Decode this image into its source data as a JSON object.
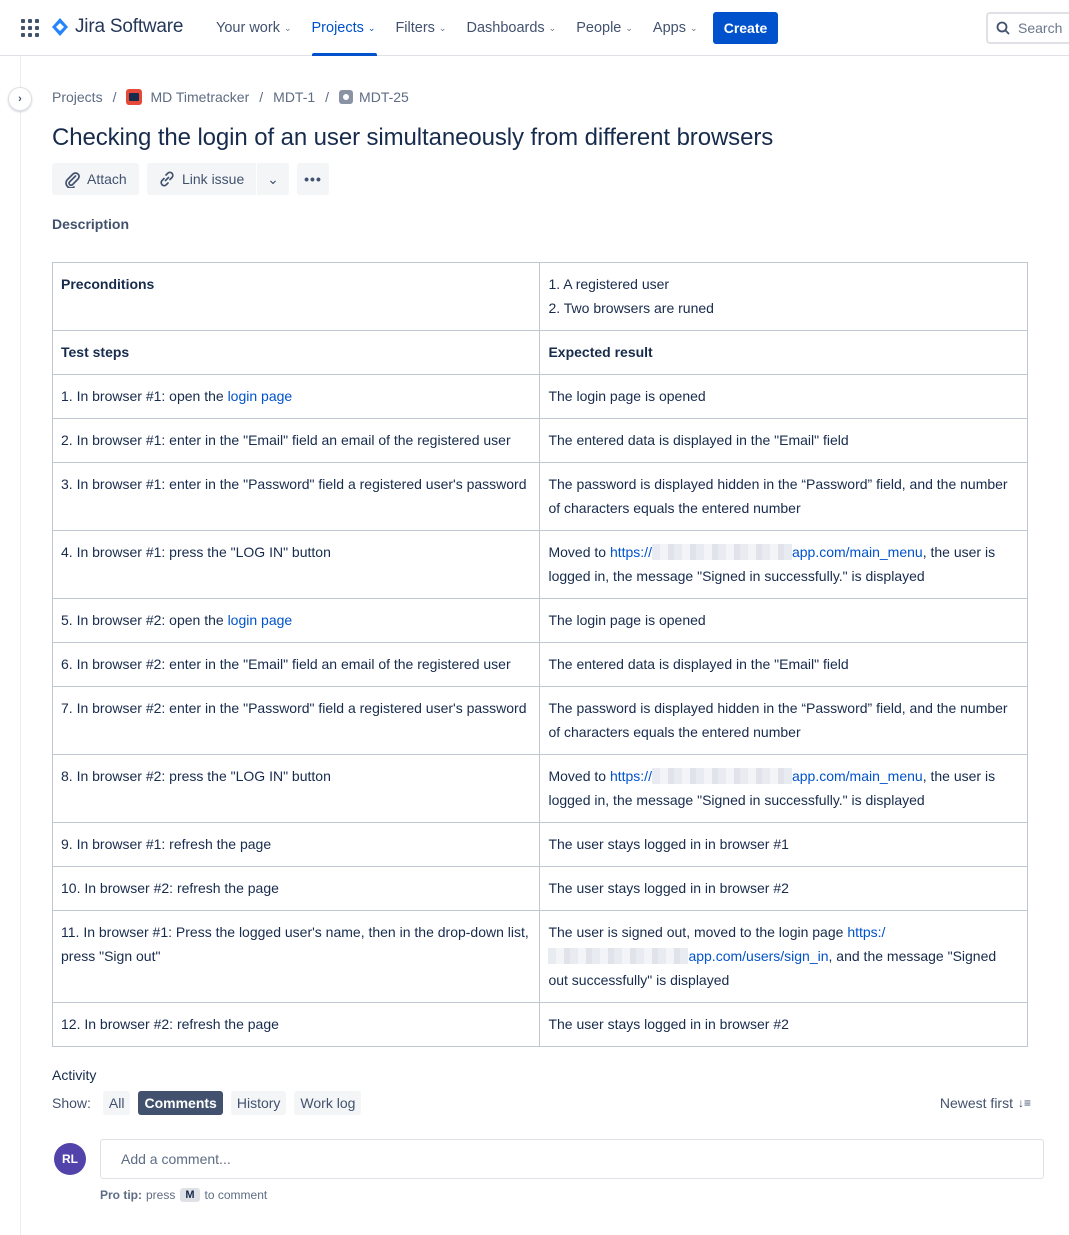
{
  "nav": {
    "product_name": "Jira Software",
    "items": [
      {
        "label": "Your work"
      },
      {
        "label": "Projects"
      },
      {
        "label": "Filters"
      },
      {
        "label": "Dashboards"
      },
      {
        "label": "People"
      },
      {
        "label": "Apps"
      }
    ],
    "active_item": "Projects",
    "create_label": "Create",
    "search_placeholder": "Search"
  },
  "breadcrumb": {
    "items": [
      "Projects",
      "MD Timetracker",
      "MDT-1",
      "MDT-25"
    ],
    "separator": "/"
  },
  "issue": {
    "title": "Checking the login of an user simultaneously from different browsers"
  },
  "toolbar": {
    "attach_label": "Attach",
    "link_label": "Link issue",
    "more_label": "•••"
  },
  "description": {
    "label": "Description",
    "preconditions_header": "Preconditions",
    "preconditions": [
      "1. A registered user",
      "2. Two browsers are runed"
    ],
    "steps_header": "Test steps",
    "result_header": "Expected result",
    "rows": [
      {
        "step_prefix": "1. In browser #1: open the ",
        "step_link": "login page",
        "result": "The login page is opened"
      },
      {
        "step": "2. In browser #1: enter in the \"Email\" field an email of the registered user",
        "result": "The entered data is displayed in the \"Email\" field"
      },
      {
        "step": "3. In browser #1: enter in the \"Password\" field a registered user's password",
        "result": "The password is displayed hidden in the “Password” field, and the number of characters equals the entered number"
      },
      {
        "step": "4. In browser #1: press the \"LOG IN\" button",
        "result_prefix": "Moved to ",
        "result_link_start": "https://",
        "result_link_end": "app.com/main_menu",
        "result_suffix": ", the user is logged in, the message \"Signed in successfully.\" is displayed"
      },
      {
        "step_prefix": "5. In browser #2: open the ",
        "step_link": "login page",
        "result": "The login page is opened"
      },
      {
        "step": "6. In browser #2: enter in the \"Email\" field an email of the registered user",
        "result": "The entered data is displayed in the \"Email\" field"
      },
      {
        "step": "7. In browser #2: enter in the \"Password\" field a registered user's password",
        "result": "The password is displayed hidden in the “Password” field, and the number of characters equals the entered number"
      },
      {
        "step": "8. In browser #2: press the \"LOG IN\" button",
        "result_prefix": "Moved to ",
        "result_link_start": "https://",
        "result_link_end": "app.com/main_menu",
        "result_suffix": ", the user is logged in, the message \"Signed in successfully.\" is displayed"
      },
      {
        "step": "9. In browser #1: refresh the page",
        "result": "The user stays logged in in browser #1"
      },
      {
        "step": "10. In browser #2: refresh the page",
        "result": "The user stays logged in in browser #2"
      },
      {
        "step": "11. In browser #1: Press the logged user's name, then in the drop-down list, press \"Sign out\"",
        "result_prefix": "The user is signed out, moved to the login page ",
        "result_link_start": "https:/",
        "result_link_end": "app.com/users/sign_in",
        "result_suffix": ", and the message \"Signed out successfully\" is displayed"
      },
      {
        "step": "12. In browser #2: refresh the page",
        "result": "The user stays logged in in browser #2"
      }
    ]
  },
  "activity": {
    "title": "Activity",
    "show_label": "Show:",
    "filters": [
      "All",
      "Comments",
      "History",
      "Work log"
    ],
    "active_filter": "Comments",
    "sort_label": "Newest first",
    "avatar_initials": "RL",
    "comment_placeholder": "Add a comment...",
    "protip_label": "Pro tip:",
    "protip_press": "press",
    "protip_key": "M",
    "protip_suffix": "to comment"
  },
  "colors": {
    "brand_blue": "#0052cc",
    "text": "#172b4d",
    "avatar": "#5243aa",
    "project_icon": "#e5493a"
  }
}
